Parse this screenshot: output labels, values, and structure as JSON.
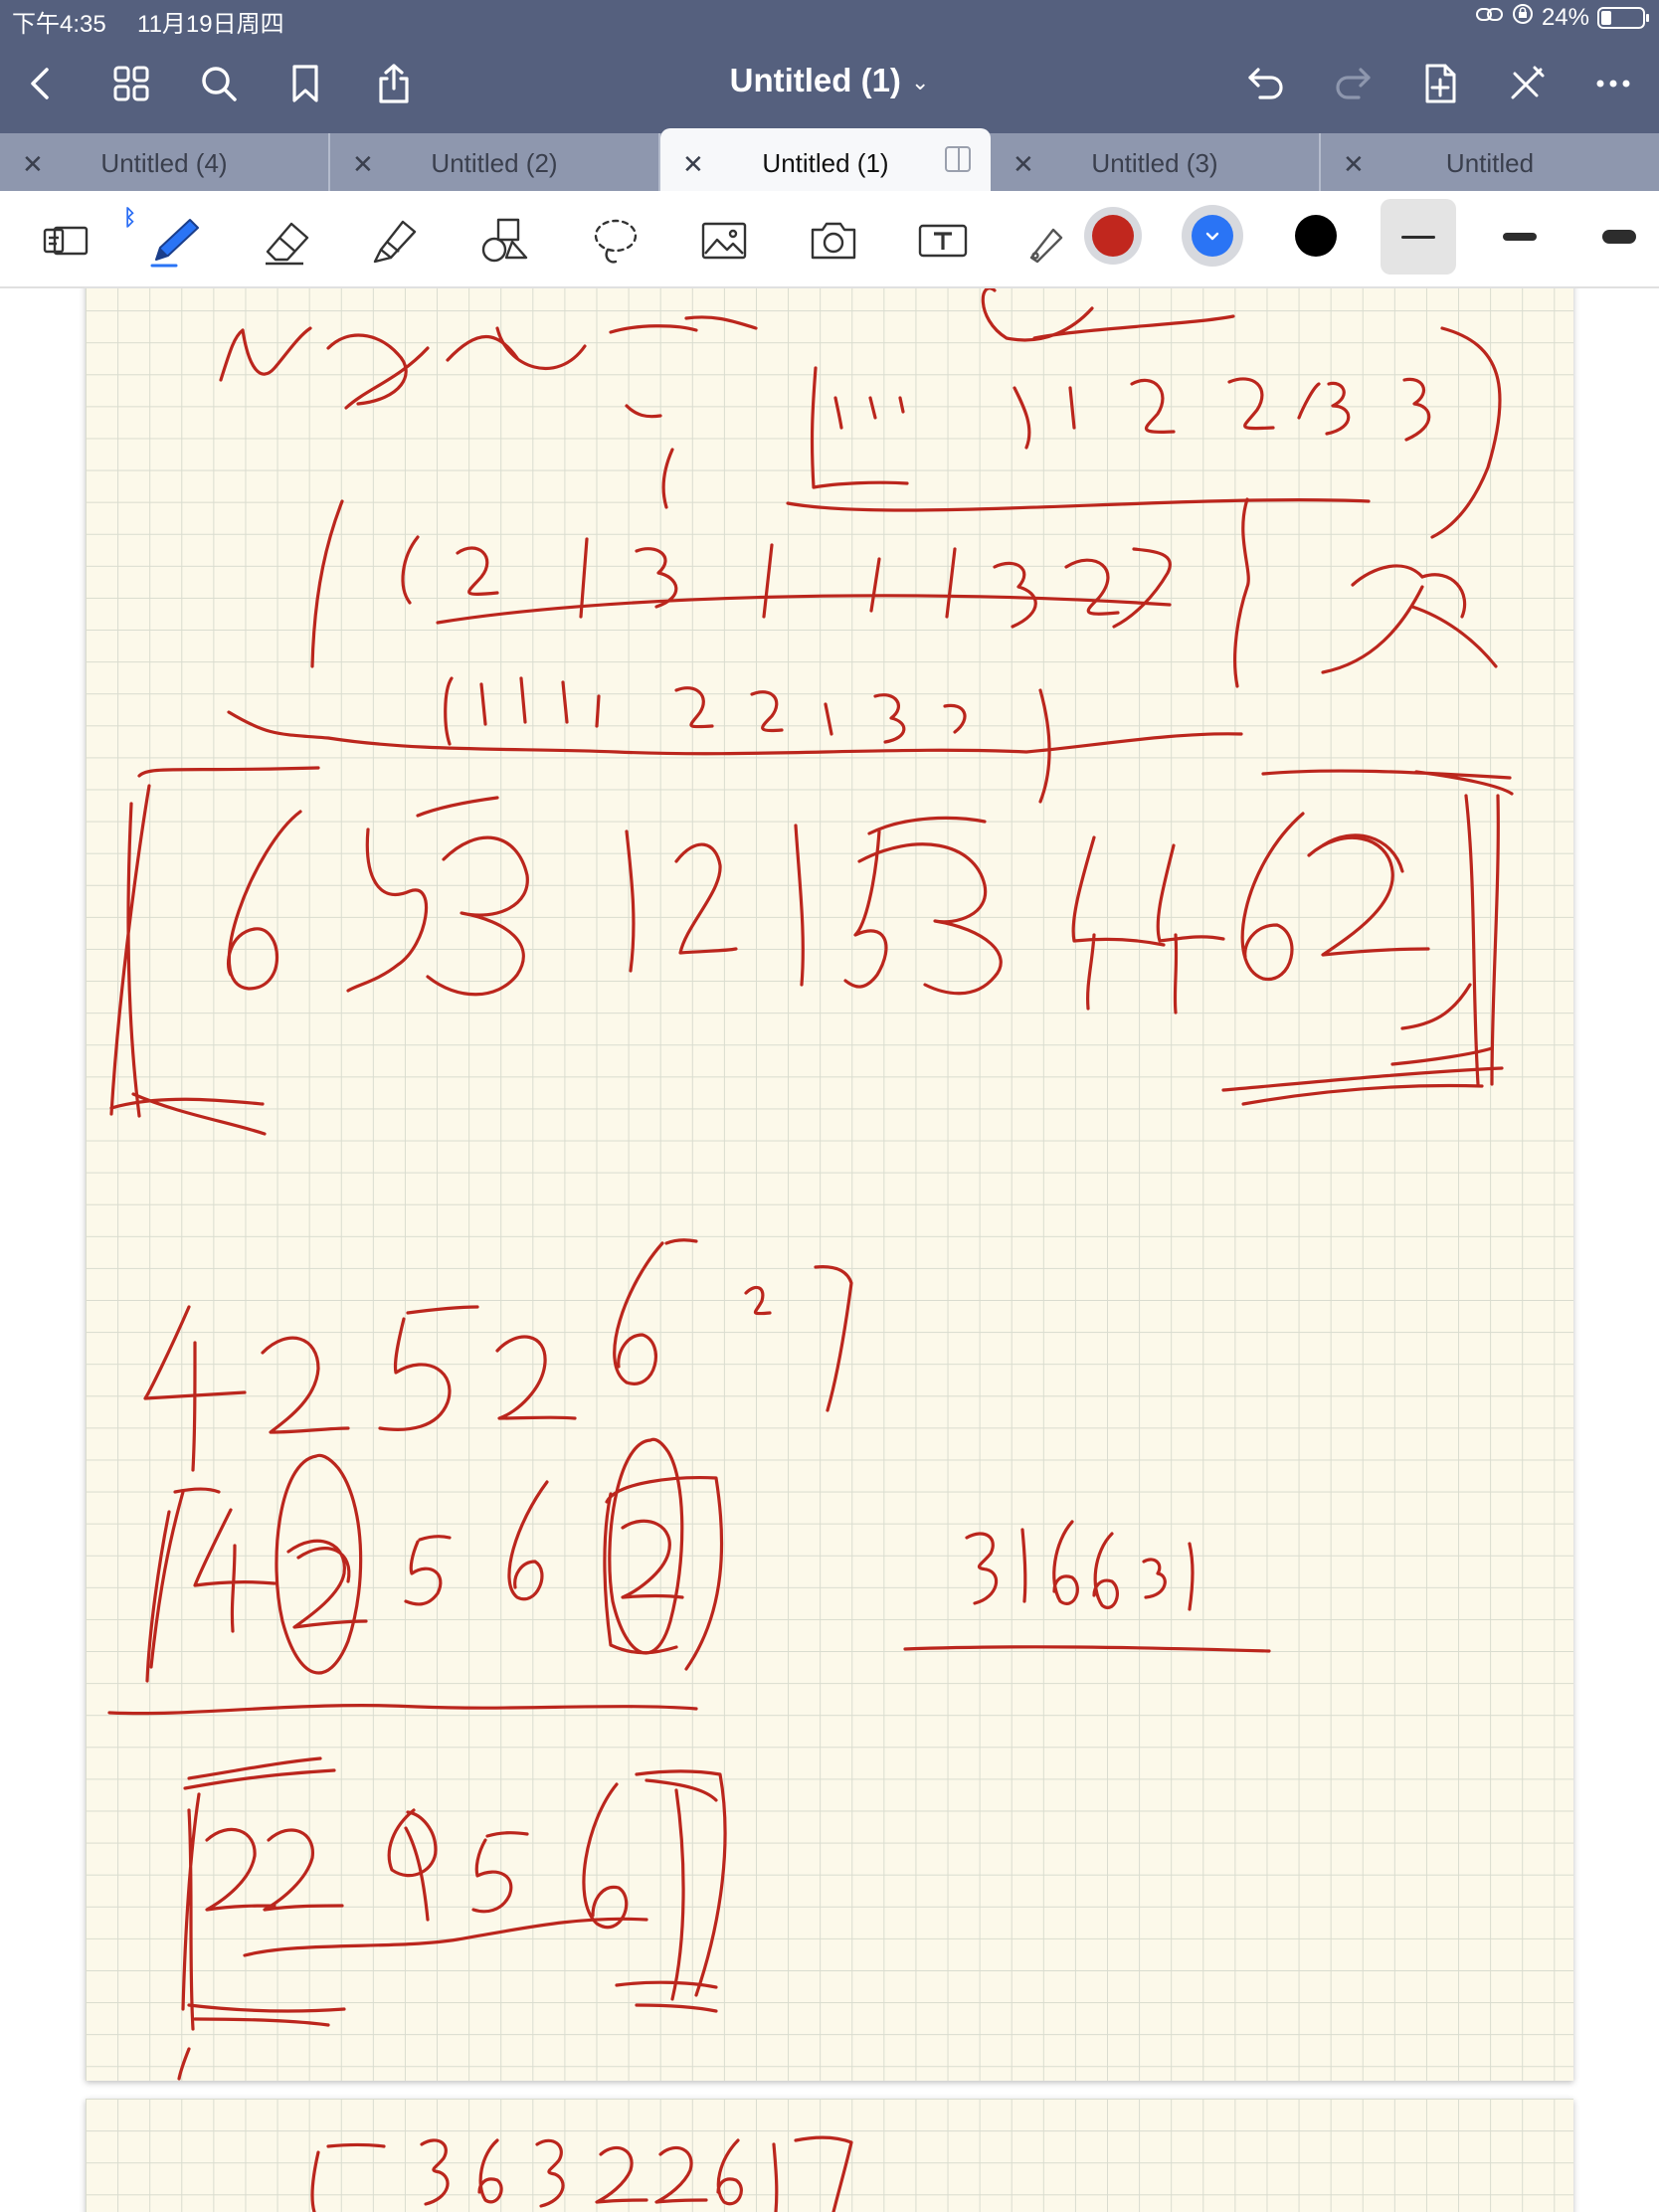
{
  "status_bar": {
    "time": "下午4:35",
    "date": "11月19日周四",
    "battery": "24%",
    "battery_level": 0.24
  },
  "nav": {
    "title": "Untitled (1)",
    "icons": [
      "back-icon",
      "grid-icon",
      "search-icon",
      "bookmark-icon",
      "share-icon",
      "undo-icon",
      "redo-icon",
      "add-page-icon",
      "pen-off-icon",
      "more-icon"
    ]
  },
  "tabs": [
    {
      "label": "Untitled (4)",
      "active": false
    },
    {
      "label": "Untitled (2)",
      "active": false
    },
    {
      "label": "Untitled (1)",
      "active": true
    },
    {
      "label": "Untitled (3)",
      "active": false
    },
    {
      "label": "Untitled",
      "active": false
    }
  ],
  "toolbar": {
    "tools": [
      "page-tool-icon",
      "pen-tool-icon",
      "eraser-tool-icon",
      "highlighter-tool-icon",
      "shapes-tool-icon",
      "lasso-tool-icon",
      "image-tool-icon",
      "camera-tool-icon",
      "text-tool-icon",
      "laser-pointer-icon"
    ],
    "selected_tool": "pen",
    "colors": [
      "#c1271e",
      "#2a74f5",
      "#000000"
    ],
    "selected_color": "#c1271e",
    "stroke_sizes": [
      "thin",
      "medium",
      "thick"
    ],
    "selected_stroke": "thin"
  },
  "canvas": {
    "ink_color": "#bb261d",
    "page_style": "grid",
    "page_color": "#fcf9ea"
  }
}
